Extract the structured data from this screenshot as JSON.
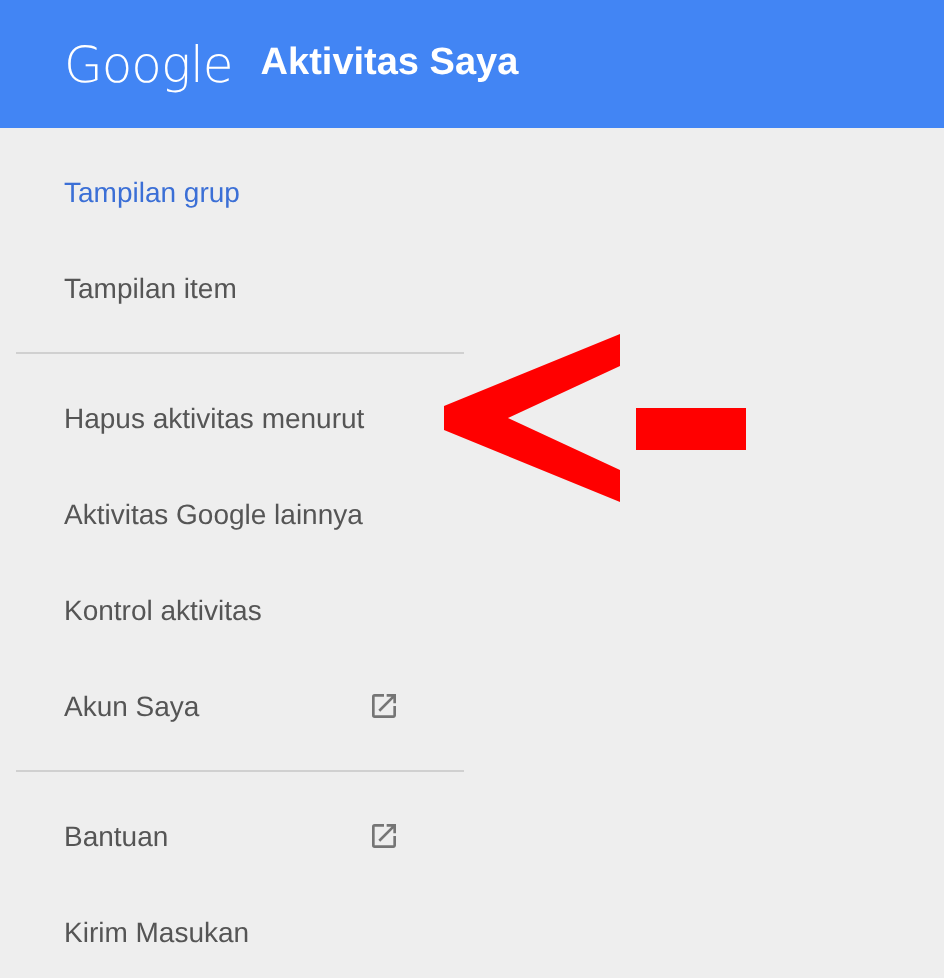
{
  "header": {
    "logo": "Google",
    "title": "Aktivitas Saya"
  },
  "menu_sections": [
    {
      "items": [
        {
          "label": "Tampilan grup",
          "selected": true,
          "external": false
        },
        {
          "label": "Tampilan item",
          "selected": false,
          "external": false
        }
      ]
    },
    {
      "items": [
        {
          "label": "Hapus aktivitas menurut",
          "selected": false,
          "external": false
        },
        {
          "label": "Aktivitas Google lainnya",
          "selected": false,
          "external": false
        },
        {
          "label": "Kontrol aktivitas",
          "selected": false,
          "external": false
        },
        {
          "label": "Akun Saya",
          "selected": false,
          "external": true
        }
      ]
    },
    {
      "items": [
        {
          "label": "Bantuan",
          "selected": false,
          "external": true
        },
        {
          "label": "Kirim Masukan",
          "selected": false,
          "external": false
        }
      ]
    }
  ]
}
